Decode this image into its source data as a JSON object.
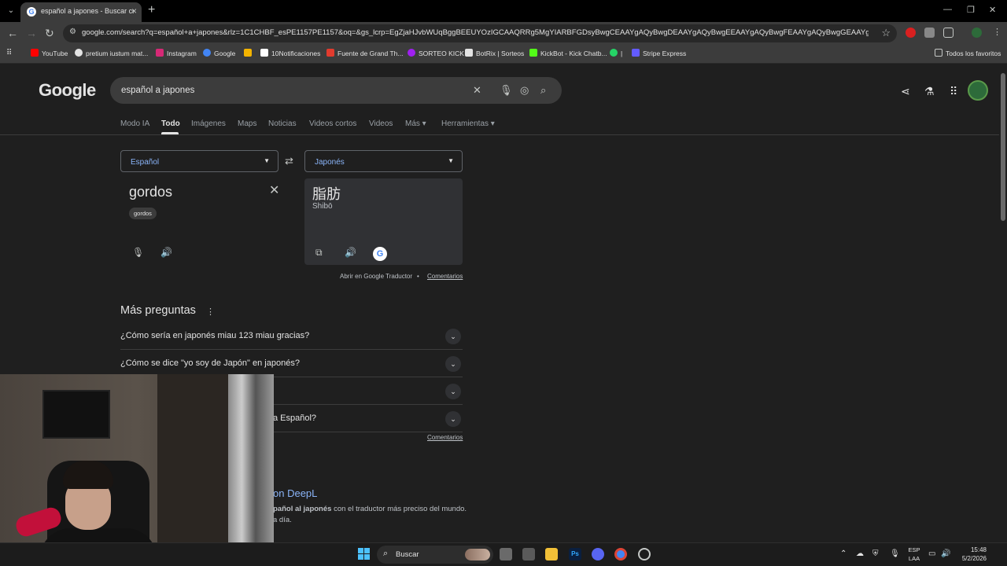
{
  "browser": {
    "tab_title": "español a japones - Buscar con Google",
    "new_tab": "+",
    "url": "google.com/search?q=español+a+japones&rlz=1C1CHBF_esPE1157PE1157&oq=&gs_lcrp=EgZjaHJvbWUqBggBEEUYOzIGCAAQRRg5MgYIARBFGDsyBwgCEAAYgAQyBwgDEAAYgAQyBwgEEAAYgAQyBwgFEAAYgAQyBwgGEAAYgAQyBggHEEUYP..."
  },
  "bookmarks": [
    {
      "label": "YouTube",
      "color": "#ff0000"
    },
    {
      "label": "pretium iustum mat...",
      "color": "#e3e3e3"
    },
    {
      "label": "Instagram",
      "color": "#d62976"
    },
    {
      "label": "Google",
      "color": "#4285f4"
    },
    {
      "label": "",
      "color": "#f4b400"
    },
    {
      "label": "10Notificaciones",
      "color": "#ffffff"
    },
    {
      "label": "Fuente de Grand Th...",
      "color": "#e23b2e"
    },
    {
      "label": "SORTEO KICK",
      "color": "#a020f0"
    },
    {
      "label": "BotRix | Sorteos",
      "color": "#e3e3e3"
    },
    {
      "label": "KickBot - Kick Chatb...",
      "color": "#53fc18"
    },
    {
      "label": "|",
      "color": "#25d366"
    },
    {
      "label": "Stripe Express",
      "color": "#635bff"
    }
  ],
  "bookmarks_all": "Todos los favoritos",
  "google": {
    "logo": "Google",
    "query": "español a japones",
    "tabs": [
      "Modo IA",
      "Todo",
      "Imágenes",
      "Maps",
      "Noticias",
      "Videos cortos",
      "Videos",
      "Más ▾",
      "Herramientas ▾"
    ],
    "active_tab": "Todo"
  },
  "translator": {
    "source_lang": "Español",
    "target_lang": "Japonés",
    "source_text": "gordos",
    "source_chip": "gordos",
    "target_text": "脂肪",
    "target_romanization": "Shibō",
    "open_link": "Abrir en Google Traductor",
    "separator": "•",
    "feedback": "Comentarios"
  },
  "paa": {
    "title": "Más preguntas",
    "questions": [
      "¿Cómo sería en japonés miau 123 miau gracias?",
      "¿Cómo se dice \"yo soy de Japón\" en japonés?",
      "",
      "a Español?"
    ],
    "feedback": "Comentarios"
  },
  "result": {
    "title": "on DeepL",
    "snippet_bold": "pañol al japonés",
    "snippet_rest": " con el traductor más preciso del mundo.",
    "snippet_line2": "a día."
  },
  "taskbar": {
    "search": "Buscar",
    "lang_top": "ESP",
    "lang_bottom": "LAA",
    "time": "15:48",
    "date": "5/2/2026"
  },
  "colors": {
    "accent": "#8ab4f8",
    "background": "#1f1f1f"
  }
}
